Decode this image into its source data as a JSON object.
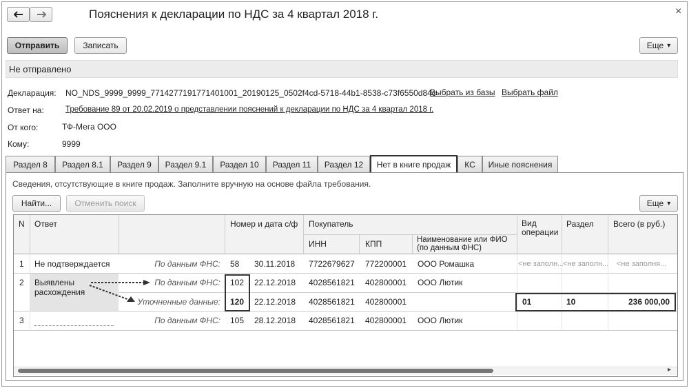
{
  "window": {
    "title": "Пояснения к декларации по НДС за 4 квартал 2018 г.",
    "back_icon": "arrow-left-icon",
    "forward_icon": "arrow-right-icon",
    "close_glyph": "×"
  },
  "toolbar": {
    "send_label": "Отправить",
    "save_label": "Записать",
    "more_label": "Еще",
    "more_arrow": "▾"
  },
  "status": {
    "text": "Не отправлено"
  },
  "fields": {
    "declaration_label": "Декларация:",
    "declaration_value": "NO_NDS_9999_9999_7714277191771401001_20190125_0502f4cd-5718-44b1-8538-c73f6550d84c",
    "select_from_db": "Выбрать из базы",
    "select_file": "Выбрать файл",
    "reply_label": "Ответ на:",
    "reply_value": "Требование 89 от 20.02.2019 о представлении пояснений к декларации по НДС за 4 квартал 2018 г.",
    "from_label": "От кого:",
    "from_value": "ТФ-Мега ООО",
    "to_label": "Кому:",
    "to_value": "9999"
  },
  "tabs": [
    {
      "label": "Раздел 8"
    },
    {
      "label": "Раздел 8.1"
    },
    {
      "label": "Раздел 9"
    },
    {
      "label": "Раздел 9.1"
    },
    {
      "label": "Раздел 10"
    },
    {
      "label": "Раздел 11"
    },
    {
      "label": "Раздел 12"
    },
    {
      "label": "Нет в книге продаж",
      "active": true
    },
    {
      "label": "КС"
    },
    {
      "label": "Иные пояснения"
    }
  ],
  "panel": {
    "info_text": "Сведения, отсутствующие в книге продаж. Заполните вручную на основе файла требования.",
    "find_label": "Найти...",
    "cancel_search_label": "Отменить поиск",
    "more_label": "Еще",
    "more_arrow": "▾"
  },
  "table": {
    "headers": {
      "n": "N",
      "answer": "Ответ",
      "invoice": "Номер и дата с/ф",
      "buyer": "Покупатель",
      "inn": "ИНН",
      "kpp": "КПП",
      "name": "Наименование или ФИО (по данным ФНС)",
      "op_type": "Вид операции",
      "section": "Раздел",
      "total": "Всего (в руб.)"
    },
    "rows": [
      {
        "n": "1",
        "answer": "Не подтверждается",
        "source": "По данным ФНС:",
        "num": "58",
        "date": "30.11.2018",
        "inn": "7722679627",
        "kpp": "772200001",
        "name": "ООО Ромашка",
        "op_type": "<не заполн...",
        "section": "<не заполн...",
        "total": "<не заполня..."
      },
      {
        "n": "2",
        "answer": "Выявлены расхождения",
        "source": "По данным ФНС:",
        "num": "102",
        "date": "22.12.2018",
        "inn": "4028561821",
        "kpp": "402800001",
        "name": "ООО Лютик",
        "op_type": "",
        "section": "",
        "total": ""
      },
      {
        "n": "",
        "answer": "",
        "source": "Уточненные данные:",
        "num": "120",
        "date": "22.12.2018",
        "inn": "4028561821",
        "kpp": "402800001",
        "name": "",
        "op_type": "01",
        "section": "10",
        "total": "236 000,00"
      },
      {
        "n": "3",
        "answer": "",
        "source": "По данным ФНС:",
        "num": "105",
        "date": "28.12.2018",
        "inn": "4028561821",
        "kpp": "402800001",
        "name": "ООО Лютик",
        "op_type": "",
        "section": "",
        "total": ""
      }
    ]
  },
  "scroll_arrow": "▸"
}
